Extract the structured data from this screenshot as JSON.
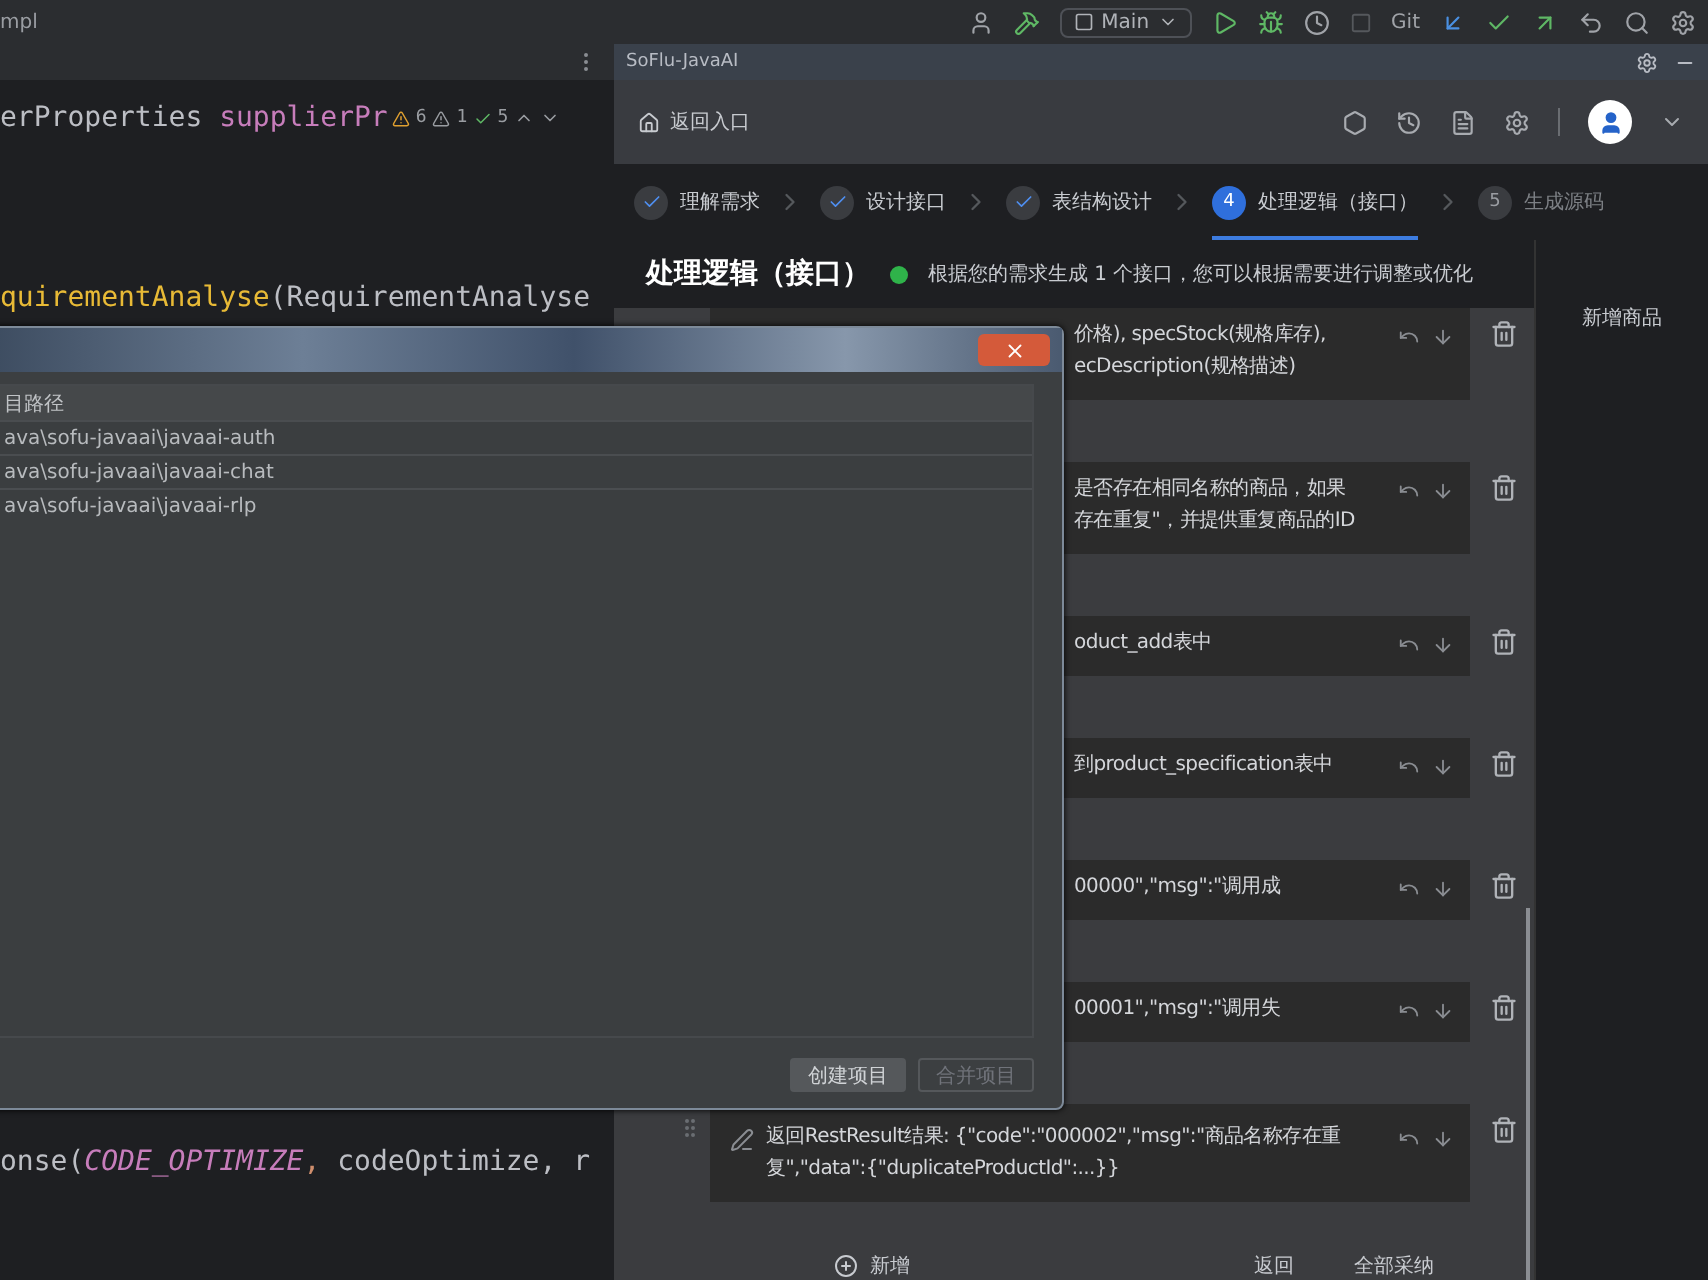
{
  "toolbar": {
    "project": "mpl",
    "branch": "Main",
    "vcs": "Git"
  },
  "editor": {
    "lines": [
      {
        "segments": [
          {
            "text": "erProperties ",
            "kind": "plain"
          },
          {
            "text": "supplierPr",
            "kind": "field"
          }
        ]
      },
      {
        "segments": [
          {
            "text": "quirementAnalyse",
            "kind": "method"
          },
          {
            "text": "(RequirementAnalyse",
            "kind": "plain"
          }
        ]
      },
      {
        "segments": [
          {
            "text": "onse(",
            "kind": "plain"
          },
          {
            "text": "CODE_OPTIMIZE",
            "kind": "constant"
          },
          {
            "text": ", ",
            "kind": "punct"
          },
          {
            "text": "codeOptimize",
            "kind": "plain"
          },
          {
            "text": ", r",
            "kind": "plain"
          }
        ]
      }
    ],
    "inspections": [
      {
        "kind": "warning",
        "count": "6"
      },
      {
        "kind": "weak",
        "count": "1"
      },
      {
        "kind": "ok",
        "count": "5"
      }
    ]
  },
  "plugin": {
    "title": "SoFlu-JavaAI",
    "back": "返回入口",
    "steps": [
      {
        "label": "理解需求",
        "done": true,
        "selected": false
      },
      {
        "label": "设计接口",
        "done": true,
        "selected": false
      },
      {
        "label": "表结构设计",
        "done": true,
        "selected": false
      },
      {
        "number": "4",
        "label": "处理逻辑（接口）",
        "done": false,
        "selected": true
      },
      {
        "number": "5",
        "label": "生成源码",
        "done": false,
        "selected": false
      }
    ],
    "heading": "处理逻辑（接口）",
    "message": "根据您的需求生成 1 个接口，您可以根据需要进行调整或优化",
    "side_item": "新增商品",
    "cards": [
      {
        "kind": "covered",
        "lines": [
          "价格), specStock(规格库存),",
          "ecDescription(规格描述)"
        ]
      },
      {
        "kind": "covered",
        "lines": [
          "是否存在相同名称的商品，如果",
          "存在重复\"，并提供重复商品的ID"
        ]
      },
      {
        "kind": "covered",
        "lines": [
          "oduct_add表中"
        ]
      },
      {
        "kind": "covered",
        "lines": [
          "到product_specification表中"
        ]
      },
      {
        "kind": "covered",
        "lines": [
          "00000\",\"msg\":\"调用成"
        ]
      },
      {
        "kind": "covered",
        "lines": [
          "00001\",\"msg\":\"调用失"
        ]
      },
      {
        "kind": "full",
        "lines": [
          "返回RestResult结果: {\"code\":\"000002\",\"msg\":\"商品名称存在重",
          "复\",\"data\":{\"duplicateProductId\":...}}"
        ]
      }
    ],
    "add": "新增",
    "buttons": [
      "返回",
      "全部采纳"
    ]
  },
  "dialog": {
    "column": "目路径",
    "rows": [
      "ava\\sofu-javaai\\javaai-auth",
      "ava\\sofu-javaai\\javaai-chat",
      "ava\\sofu-javaai\\javaai-rlp"
    ],
    "buttons": [
      {
        "label": "创建项目",
        "disabled": false
      },
      {
        "label": "合并项目",
        "disabled": true
      }
    ]
  }
}
